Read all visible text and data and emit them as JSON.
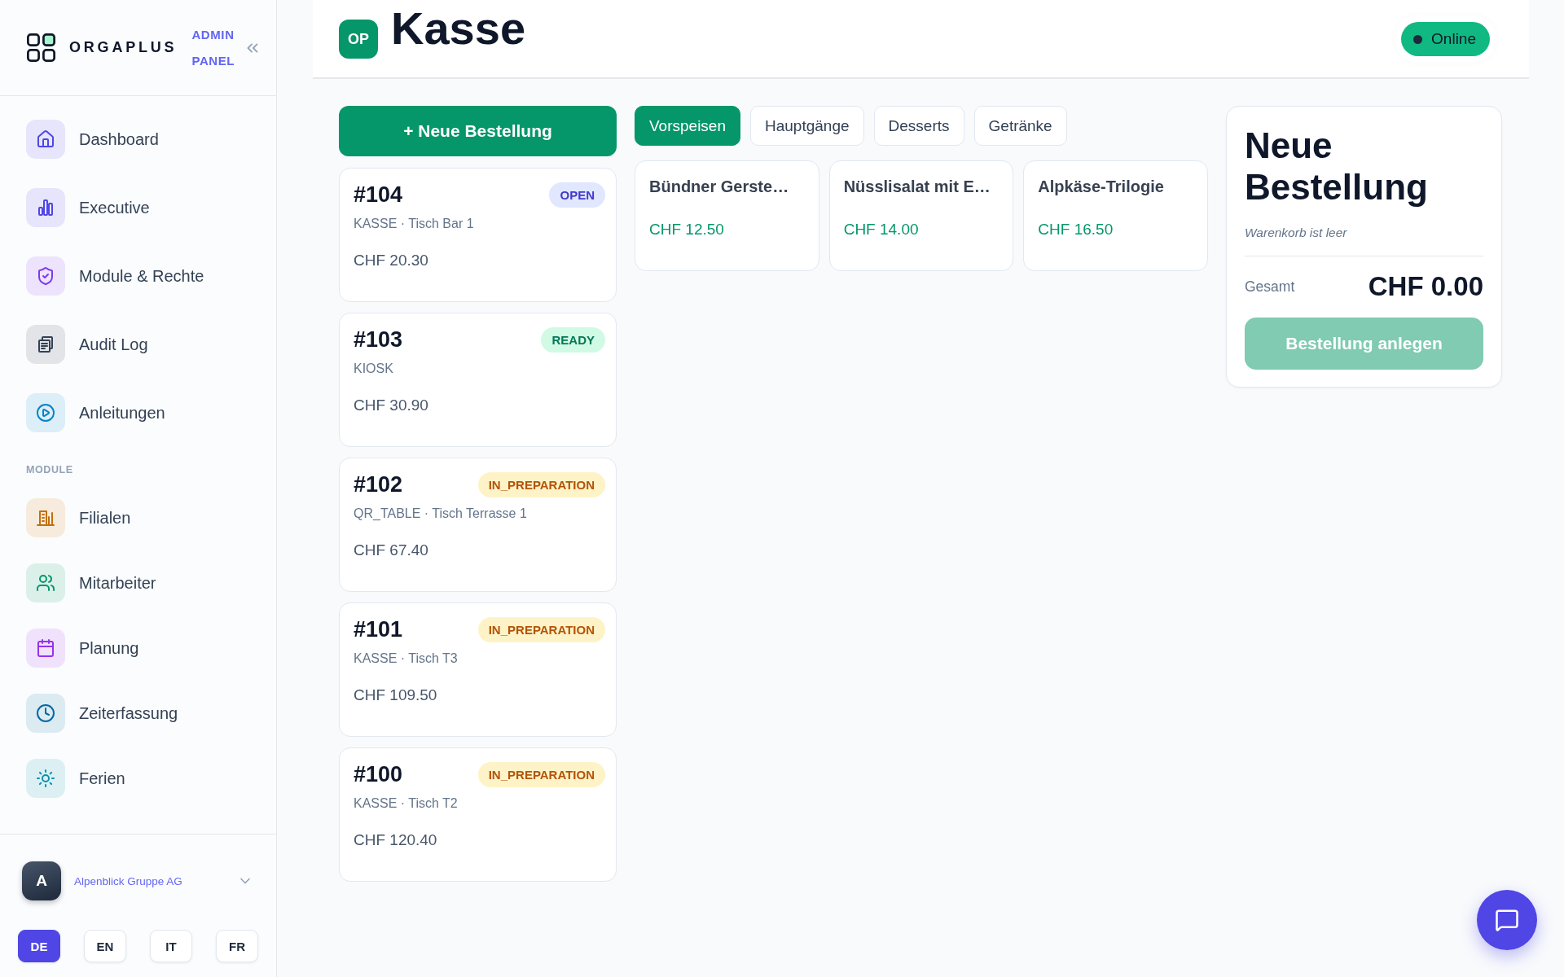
{
  "sidebar": {
    "brand": {
      "name": "ORGAPLUS",
      "tag": "ADMIN PANEL"
    },
    "nav_groups": [
      {
        "items": [
          {
            "label": "Dashboard",
            "color": "#4f46e5",
            "selected": false
          },
          {
            "label": "Executive",
            "color": "#4f46e5",
            "selected": false
          },
          {
            "label": "Module & Rechte",
            "color": "#7c3aed",
            "selected": false
          },
          {
            "label": "Audit Log",
            "color": "#334155",
            "selected": false
          },
          {
            "label": "Anleitungen",
            "color": "#0284c7",
            "selected": false
          }
        ]
      },
      {
        "title": "MODULE",
        "items": [
          {
            "label": "Filialen",
            "color": "#c2700c",
            "selected": false
          },
          {
            "label": "Mitarbeiter",
            "color": "#059669",
            "selected": false
          },
          {
            "label": "Planung",
            "color": "#9333ea",
            "selected": false
          },
          {
            "label": "Zeiterfassung",
            "color": "#0369a1",
            "selected": false
          },
          {
            "label": "Ferien",
            "color": "#0891b2",
            "selected": false
          }
        ]
      }
    ],
    "organization": {
      "initial": "A",
      "name": "Alpenblick Gruppe AG"
    },
    "languages": [
      {
        "label": "DE",
        "selected": true
      },
      {
        "label": "EN",
        "selected": false
      },
      {
        "label": "IT",
        "selected": false
      },
      {
        "label": "FR",
        "selected": false
      }
    ]
  },
  "header": {
    "app_badge": "OP",
    "title": "Kasse",
    "status": {
      "label": "Online",
      "online": true
    }
  },
  "orders": {
    "new_button": "+ Neue Bestellung",
    "items": [
      {
        "number": "#104",
        "badge": {
          "label": "OPEN",
          "kind": "open"
        },
        "source": "KASSE · Tisch Bar 1",
        "total": "CHF 20.30"
      },
      {
        "number": "#103",
        "badge": {
          "label": "READY",
          "kind": "ready"
        },
        "source": "KIOSK",
        "total": "CHF 30.90"
      },
      {
        "number": "#102",
        "badge": {
          "label": "IN_PREPARATION",
          "kind": "in_preparation"
        },
        "source": "QR_TABLE · Tisch Terrasse 1",
        "total": "CHF 67.40"
      },
      {
        "number": "#101",
        "badge": {
          "label": "IN_PREPARATION",
          "kind": "in_preparation"
        },
        "source": "KASSE · Tisch T3",
        "total": "CHF 109.50"
      },
      {
        "number": "#100",
        "badge": {
          "label": "IN_PREPARATION",
          "kind": "in_preparation"
        },
        "source": "KASSE · Tisch T2",
        "total": "CHF 120.40"
      }
    ]
  },
  "menu": {
    "tabs": [
      {
        "label": "Vorspeisen",
        "selected": true
      },
      {
        "label": "Hauptgänge",
        "selected": false
      },
      {
        "label": "Desserts",
        "selected": false
      },
      {
        "label": "Getränke",
        "selected": false
      }
    ],
    "products": [
      {
        "name": "Bündner Gerste…",
        "price": "CHF 12.50"
      },
      {
        "name": "Nüsslisalat mit E…",
        "price": "CHF 14.00"
      },
      {
        "name": "Alpkäse-Trilogie",
        "price": "CHF 16.50"
      }
    ]
  },
  "cart": {
    "title": "Neue Bestellung",
    "empty_text": "Warenkorb ist leer",
    "total_label": "Gesamt",
    "total": "CHF 0.00",
    "submit": {
      "label": "Bestellung anlegen",
      "disabled": true
    }
  }
}
